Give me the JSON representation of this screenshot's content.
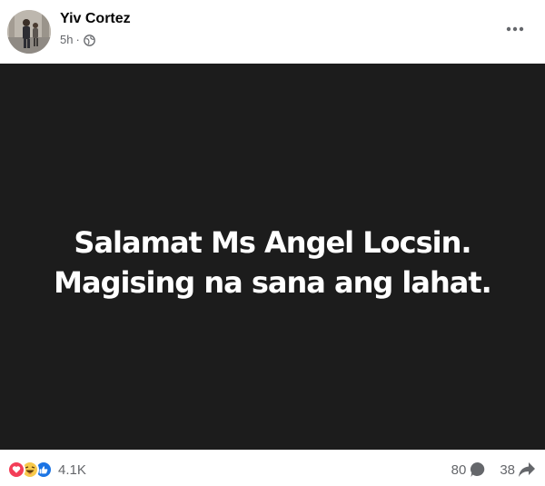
{
  "post": {
    "author": "Yiv Cortez",
    "time": "5h",
    "separator": "·",
    "privacy_icon": "globe-icon",
    "menu_icon": "more-options-icon",
    "image_text_line1": "Salamat Ms Angel Locsin.",
    "image_text_line2": "Magising na sana ang lahat."
  },
  "footer": {
    "reaction_icons": [
      "love-reaction-icon",
      "haha-reaction-icon",
      "like-reaction-icon"
    ],
    "reaction_count": "4.1K",
    "comment_count": "80",
    "share_count": "38"
  },
  "colors": {
    "image_background": "#1c1c1c",
    "love": "#f33e58",
    "haha": "#f7c94b",
    "like": "#1b74e4",
    "meta_text": "#65676b"
  }
}
